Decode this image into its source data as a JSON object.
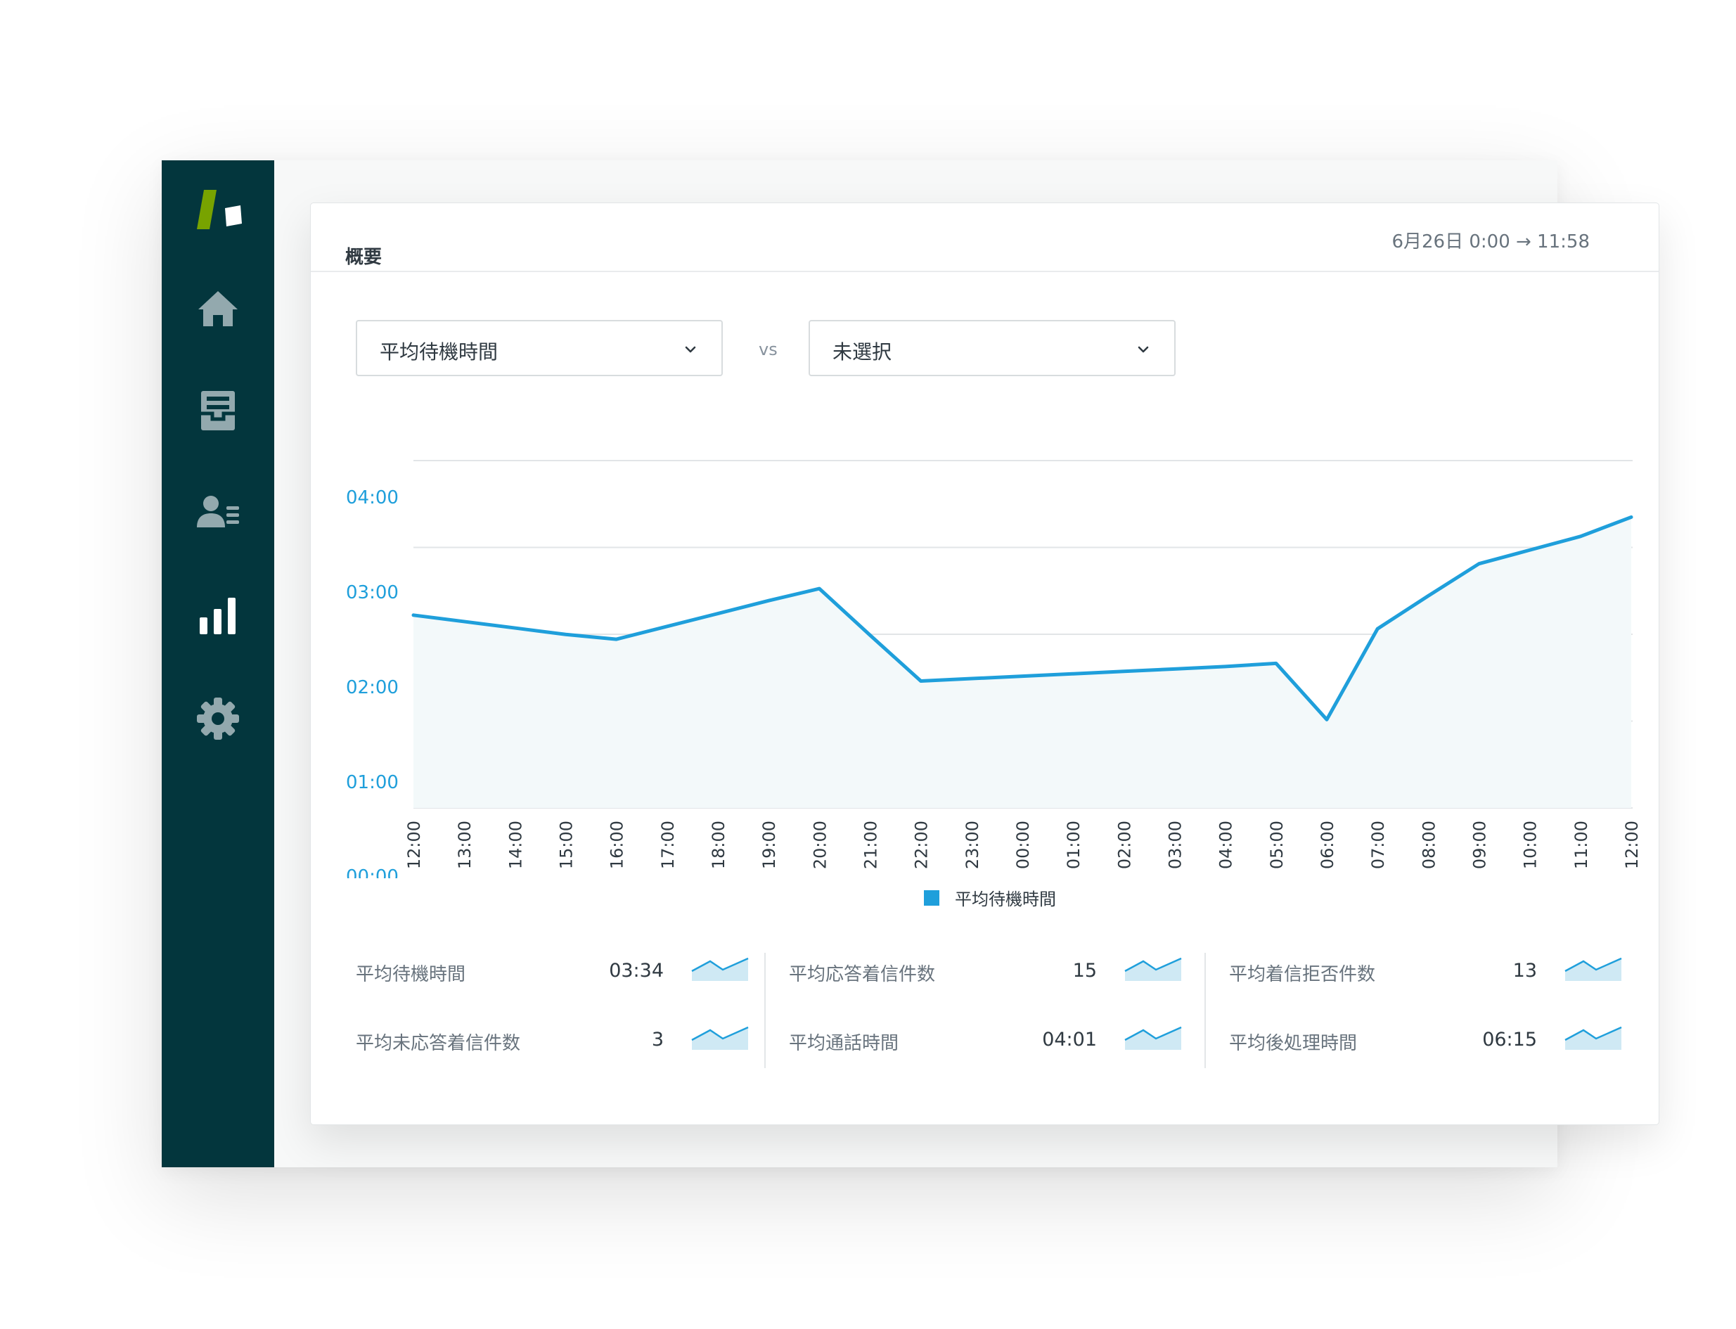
{
  "sidebar": {
    "logo": "zendesk-logo",
    "items": [
      {
        "icon": "home-icon"
      },
      {
        "icon": "inbox-icon"
      },
      {
        "icon": "contacts-icon"
      },
      {
        "icon": "reporting-icon"
      },
      {
        "icon": "gear-icon"
      }
    ]
  },
  "card": {
    "title": "概要",
    "date_range": "6月26日 0:00 → 11:58"
  },
  "filters": {
    "metric_primary": "平均待機時間",
    "vs_label": "vs",
    "metric_compare": "未選択"
  },
  "chart_data": {
    "type": "area",
    "x": [
      "12:00",
      "13:00",
      "14:00",
      "15:00",
      "16:00",
      "17:00",
      "18:00",
      "19:00",
      "20:00",
      "21:00",
      "22:00",
      "23:00",
      "00:00",
      "01:00",
      "02:00",
      "03:00",
      "04:00",
      "05:00",
      "06:00",
      "07:00",
      "08:00",
      "09:00",
      "10:00",
      "11:00",
      "12:00"
    ],
    "series": [
      {
        "name": "平均待機時間",
        "values": [
          2.4,
          2.32,
          2.24,
          2.16,
          2.1,
          2.26,
          2.42,
          2.58,
          2.73,
          2.15,
          1.58,
          1.61,
          1.64,
          1.67,
          1.7,
          1.73,
          1.76,
          1.8,
          1.1,
          2.23,
          2.64,
          3.04,
          3.21,
          3.38,
          3.62
        ]
      }
    ],
    "yticks": [
      "00:00",
      "01:00",
      "02:00",
      "03:00",
      "04:00"
    ],
    "ylim": [
      0,
      4
    ],
    "grid": true,
    "legend": "bottom-center",
    "colors": {
      "line": "#1f9fdb",
      "area": "#f3f9fa",
      "tick": "#1f9fdb"
    }
  },
  "metrics": [
    [
      {
        "label": "平均待機時間",
        "value": "03:34"
      },
      {
        "label": "平均未応答着信件数",
        "value": "3"
      }
    ],
    [
      {
        "label": "平均応答着信件数",
        "value": "15"
      },
      {
        "label": "平均通話時間",
        "value": "04:01"
      }
    ],
    [
      {
        "label": "平均着信拒否件数",
        "value": "13"
      },
      {
        "label": "平均後処理時間",
        "value": "06:15"
      }
    ]
  ]
}
